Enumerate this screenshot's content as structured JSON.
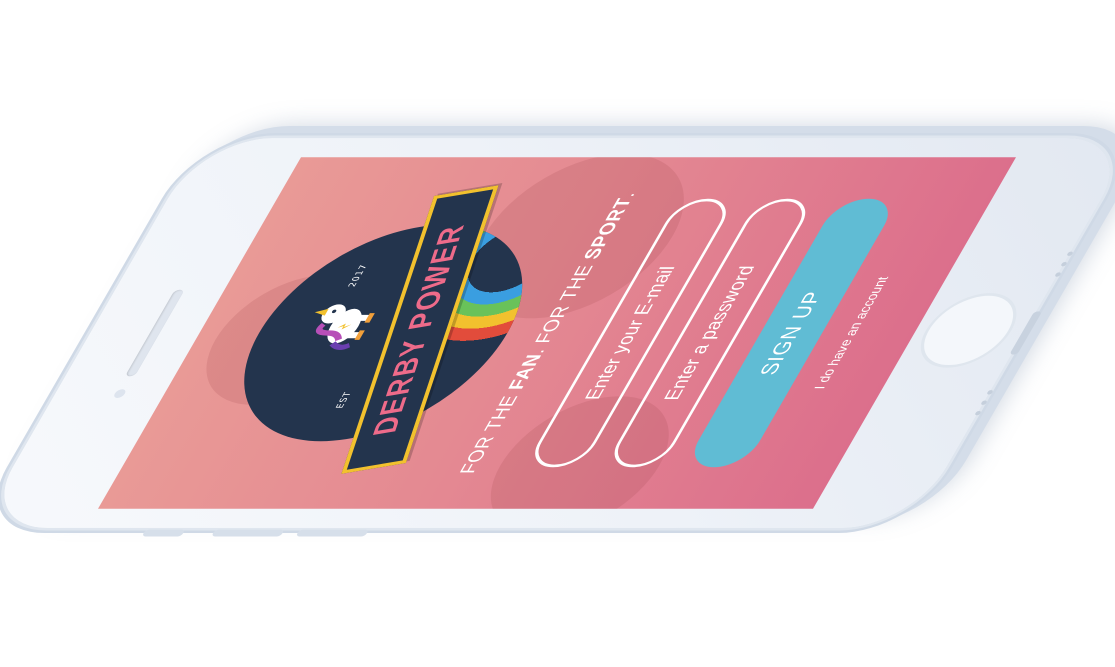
{
  "app": {
    "name": "Derby Power"
  },
  "logo": {
    "banner_text": "DERBY POWER",
    "est_label": "EST",
    "year_label": "2017",
    "mascot_icon": "unicorn-icon",
    "colors": {
      "badge": "#23344d",
      "banner_border": "#f2c12e",
      "banner_text": "#ee6b8a",
      "rainbow": [
        "#e24c3b",
        "#f2c12e",
        "#69c25a",
        "#3a9ee0"
      ]
    }
  },
  "tagline": {
    "part1": "FOR THE ",
    "bold1": "FAN",
    "part2": ". FOR THE ",
    "bold2": "SPORT",
    "part3": "."
  },
  "form": {
    "email_placeholder": "Enter your E-mail",
    "password_placeholder": "Enter a password",
    "signup_label": "SIGN UP",
    "account_link": "I do have an account"
  },
  "theme": {
    "background_top": "#e99a96",
    "background_bottom": "#dc6f8c",
    "button": "#60bcd4",
    "text": "#ffffff"
  }
}
